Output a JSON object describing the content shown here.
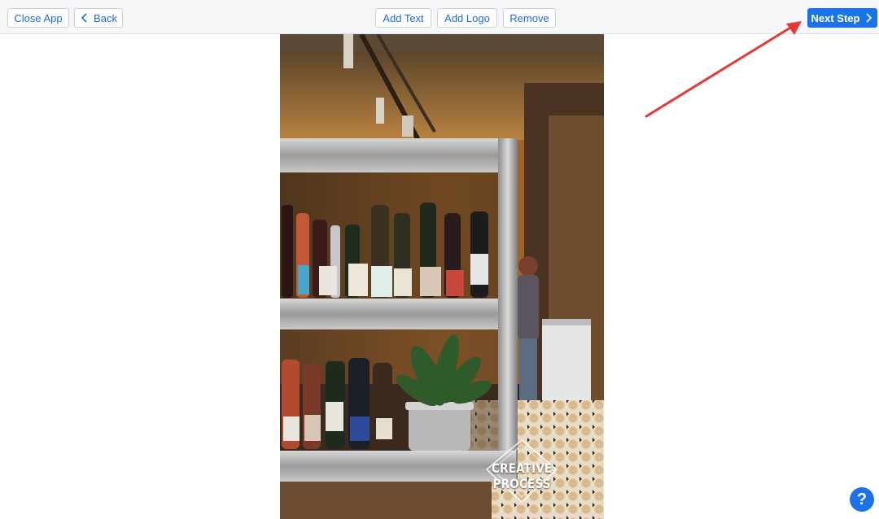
{
  "toolbar": {
    "close_app_label": "Close App",
    "back_label": "Back",
    "add_text_label": "Add Text",
    "add_logo_label": "Add Logo",
    "remove_label": "Remove",
    "next_step_label": "Next Step"
  },
  "photo": {
    "watermark_text": "CREATIVE PROCESS",
    "icons": [
      "diamond-frame-icon"
    ]
  },
  "help": {
    "label": "?"
  },
  "colors": {
    "accent": "#1a73e8",
    "button_text": "#1f69d6",
    "toolbar_bg": "#f5f6f7",
    "annotation_arrow": "#e53935"
  },
  "icons": [
    "chevron-left-icon",
    "chevron-right-icon",
    "help-icon",
    "annotation-arrow"
  ]
}
